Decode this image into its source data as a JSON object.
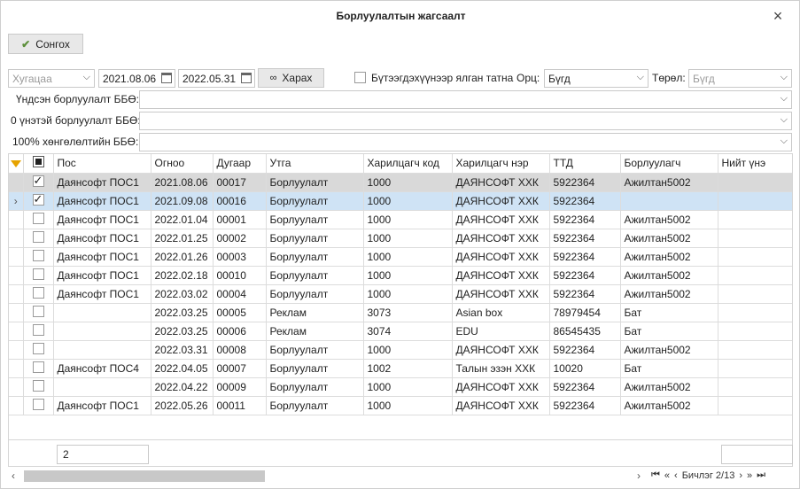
{
  "window": {
    "title": "Борлуулалтын жагсаалт"
  },
  "toolbar": {
    "select_label": "Сонгох"
  },
  "filters": {
    "period_placeholder": "Хугацаа",
    "date_from": "2021.08.06",
    "date_to": "2022.05.31",
    "search_label": "Харах",
    "full_list_label": "Бүтээгдэхүүнээр ялган татна",
    "income_label": "Орц:",
    "income_value": "Бүгд",
    "type_label": "Төрөл:",
    "type_value": "Бүгд",
    "main_sales_label": "Үндсэн борлуулалт ББӨ:",
    "zero_vat_label": "0 үнэтэй борлуулалт ББӨ:",
    "full_consume_label": "100% хөнгөлөлтийн ББӨ:"
  },
  "grid": {
    "columns": [
      "Пос",
      "Огноо",
      "Дугаар",
      "Утга",
      "Харилцагч код",
      "Харилцагч нэр",
      "ТТД",
      "Борлуулагч",
      "Нийт үнэ"
    ],
    "rows": [
      {
        "checked": true,
        "pos": "Даянсофт ПОС1",
        "date": "2021.08.06",
        "num": "00017",
        "desc": "Борлуулалт",
        "code": "1000",
        "name": "ДАЯНСОФТ ХХК",
        "ttd": "5922364",
        "seller": "Ажилтан5002",
        "total": ""
      },
      {
        "checked": true,
        "pos": "Даянсофт ПОС1",
        "date": "2021.09.08",
        "num": "00016",
        "desc": "Борлуулалт",
        "code": "1000",
        "name": "ДАЯНСОФТ ХХК",
        "ttd": "5922364",
        "seller": "",
        "total": ""
      },
      {
        "checked": false,
        "pos": "Даянсофт ПОС1",
        "date": "2022.01.04",
        "num": "00001",
        "desc": "Борлуулалт",
        "code": "1000",
        "name": "ДАЯНСОФТ ХХК",
        "ttd": "5922364",
        "seller": "Ажилтан5002",
        "total": ""
      },
      {
        "checked": false,
        "pos": "Даянсофт ПОС1",
        "date": "2022.01.25",
        "num": "00002",
        "desc": "Борлуулалт",
        "code": "1000",
        "name": "ДАЯНСОФТ ХХК",
        "ttd": "5922364",
        "seller": "Ажилтан5002",
        "total": ""
      },
      {
        "checked": false,
        "pos": "Даянсофт ПОС1",
        "date": "2022.01.26",
        "num": "00003",
        "desc": "Борлуулалт",
        "code": "1000",
        "name": "ДАЯНСОФТ ХХК",
        "ttd": "5922364",
        "seller": "Ажилтан5002",
        "total": ""
      },
      {
        "checked": false,
        "pos": "Даянсофт ПОС1",
        "date": "2022.02.18",
        "num": "00010",
        "desc": "Борлуулалт",
        "code": "1000",
        "name": "ДАЯНСОФТ ХХК",
        "ttd": "5922364",
        "seller": "Ажилтан5002",
        "total": ""
      },
      {
        "checked": false,
        "pos": "Даянсофт ПОС1",
        "date": "2022.03.02",
        "num": "00004",
        "desc": "Борлуулалт",
        "code": "1000",
        "name": "ДАЯНСОФТ ХХК",
        "ttd": "5922364",
        "seller": "Ажилтан5002",
        "total": ""
      },
      {
        "checked": false,
        "pos": "",
        "date": "2022.03.25",
        "num": "00005",
        "desc": "Реклам",
        "code": "3073",
        "name": "Asian box",
        "ttd": "78979454",
        "seller": "Бат",
        "total": ""
      },
      {
        "checked": false,
        "pos": "",
        "date": "2022.03.25",
        "num": "00006",
        "desc": "Реклам",
        "code": "3074",
        "name": "EDU",
        "ttd": "86545435",
        "seller": "Бат",
        "total": ""
      },
      {
        "checked": false,
        "pos": "",
        "date": "2022.03.31",
        "num": "00008",
        "desc": "Борлуулалт",
        "code": "1000",
        "name": "ДАЯНСОФТ ХХК",
        "ttd": "5922364",
        "seller": "Ажилтан5002",
        "total": ""
      },
      {
        "checked": false,
        "pos": "Даянсофт ПОС4",
        "date": "2022.04.05",
        "num": "00007",
        "desc": "Борлуулалт",
        "code": "1002",
        "name": "Талын эзэн ХХК",
        "ttd": "10020",
        "seller": "Бат",
        "total": ""
      },
      {
        "checked": false,
        "pos": "",
        "date": "2022.04.22",
        "num": "00009",
        "desc": "Борлуулалт",
        "code": "1000",
        "name": "ДАЯНСОФТ ХХК",
        "ttd": "5922364",
        "seller": "Ажилтан5002",
        "total": ""
      },
      {
        "checked": false,
        "pos": "Даянсофт ПОС1",
        "date": "2022.05.26",
        "num": "00011",
        "desc": "Борлуулалт",
        "code": "1000",
        "name": "ДАЯНСОФТ ХХК",
        "ttd": "5922364",
        "seller": "Ажилтан5002",
        "total": ""
      }
    ]
  },
  "footer": {
    "count": "2",
    "page_label": "Бичлэг 2/13"
  }
}
